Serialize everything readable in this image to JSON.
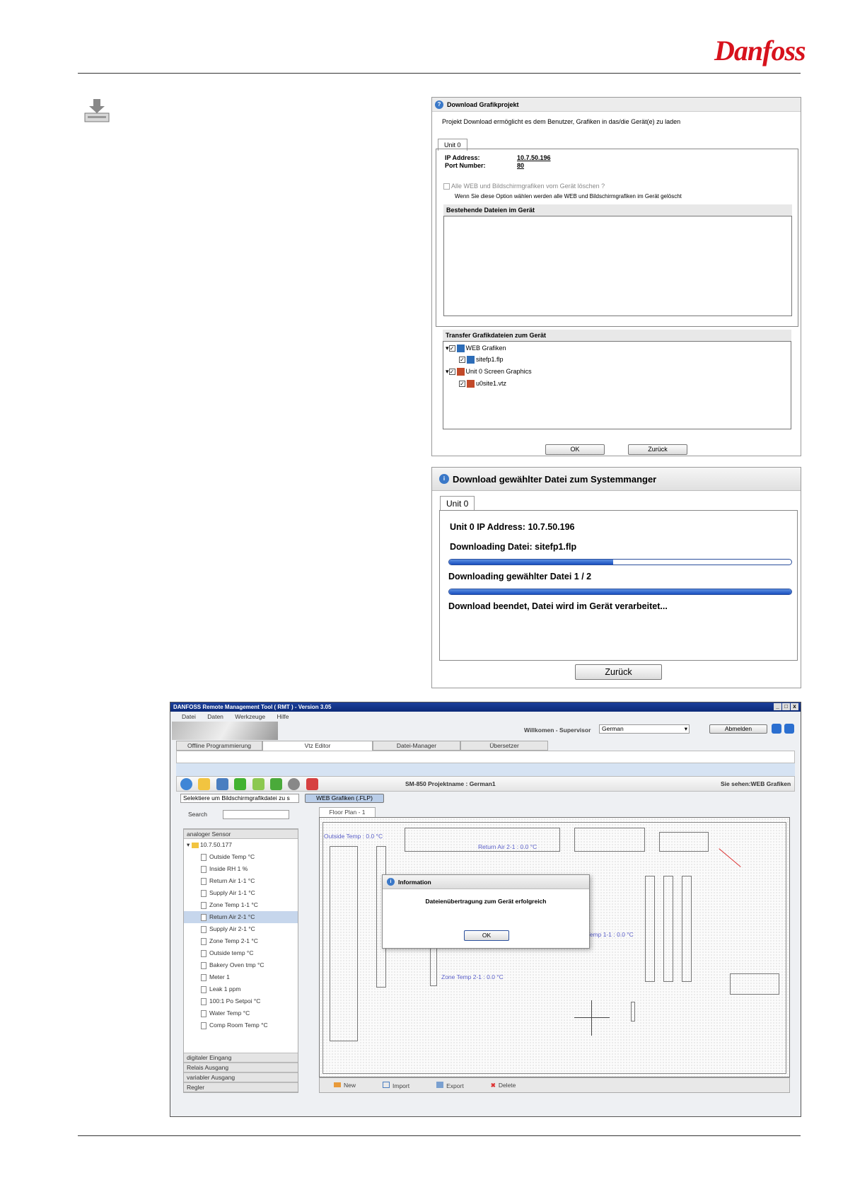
{
  "header": {
    "logo_text": "Danfoss"
  },
  "download_icon": "download-tray-icon",
  "dialog1": {
    "title": "Download Grafikprojekt",
    "description": "Projekt Download ermöglicht es dem Benutzer, Grafiken in das/die Gerät(e) zu laden",
    "tab": "Unit 0",
    "ip_label": "IP Address:",
    "ip_value": "10.7.50.196",
    "port_label": "Port Number:",
    "port_value": "80",
    "delete_option": "Alle WEB und Bildschirmgrafiken vom Gerät löschen ?",
    "delete_note": "Wenn Sie diese Option wählen werden alle WEB und Bildschirmgrafiken im Gerät gelöscht",
    "existing_files_header": "Bestehende Dateien im Gerät",
    "transfer_header": "Transfer Grafikdateien zum Gerät",
    "tree": [
      {
        "label": "WEB Grafiken",
        "level": 0
      },
      {
        "label": "sitefp1.flp",
        "level": 1
      },
      {
        "label": "Unit 0 Screen Graphics",
        "level": 0
      },
      {
        "label": "u0site1.vtz",
        "level": 1
      }
    ],
    "ok": "OK",
    "back": "Zurück"
  },
  "dialog2": {
    "title": "Download gewählter Datei zum Systemmanger",
    "tab": "Unit 0",
    "ip_line": "Unit 0 IP Address: 10.7.50.196",
    "file_line": "Downloading Datei: sitefp1.flp",
    "file_progress": 0.48,
    "count_line": "Downloading gewählter Datei 1 / 2",
    "count_progress": 1.0,
    "done_line": "Download beendet, Datei wird im Gerät verarbeitet...",
    "back": "Zurück"
  },
  "rmt": {
    "title": "DANFOSS Remote Management Tool ( RMT ) - Version 3.05",
    "window_controls": [
      "_",
      "□",
      "x"
    ],
    "menu": [
      "Datei",
      "Daten",
      "Werkzeuge",
      "Hilfe"
    ],
    "welcome": "Willkomen - Supervisor",
    "language": "German",
    "logout": "Abmelden",
    "tabs": [
      "Offline Programmierung",
      "Vtz Editor",
      "Datei-Manager",
      "Übersetzer"
    ],
    "project": "SM-850 Projektname : German1",
    "view": "Sie sehen:WEB Grafiken",
    "select_placeholder": "Selektiere um Bildschirmgrafikdatei zu s",
    "web_button": "WEB Grafiken (.FLP)",
    "search_label": "Search",
    "category_open": "analoger Sensor",
    "tree_root": "10.7.50.177",
    "sensors": [
      "Outside Temp °C",
      "Inside RH 1 %",
      "Return Air 1-1 °C",
      "Supply Air 1-1 °C",
      "Zone Temp 1-1 °C",
      "Return Air 2-1 °C",
      "Supply Air 2-1 °C",
      "Zone Temp 2-1 °C",
      "Outside temp °C",
      "Bakery Oven tmp °C",
      "Meter 1",
      "Leak 1 ppm",
      "100:1 Po Setpoi °C",
      "Water Temp °C",
      "Comp Room Temp °C"
    ],
    "selected_sensor": "Return Air 2-1 °C",
    "categories": [
      "digitaler Eingang",
      "Relais Ausgang",
      "variabler Ausgang",
      "Regler"
    ],
    "plan_tab": "Floor Plan - 1",
    "plan_labels": [
      "Outside Temp : 0.0 °C",
      "Return Air 2-1 : 0.0 °C",
      "Zone Temp 1-1 : 0.0 °C",
      "Zone Temp 2-1 : 0.0 °C"
    ],
    "info_title": "Information",
    "info_message": "Dateienübertragung zum Gerät erfolgreich",
    "info_ok": "OK",
    "bottom_actions": [
      "New",
      "Import",
      "Export",
      "Delete"
    ],
    "toolbar_icons": [
      "new-icon",
      "open-folder-icon",
      "save-icon",
      "add-icon",
      "upload-icon",
      "download-icon",
      "globe-icon",
      "close-icon"
    ]
  }
}
